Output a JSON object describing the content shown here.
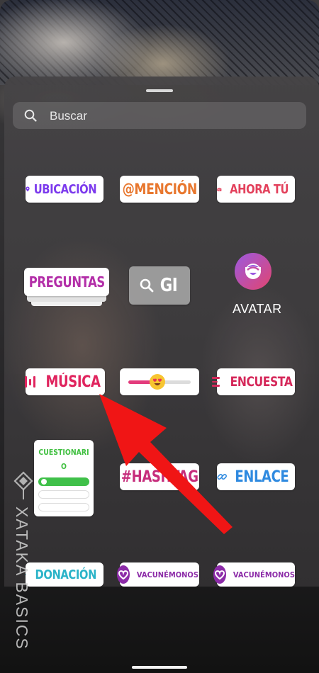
{
  "search": {
    "placeholder": "Buscar"
  },
  "stickers": {
    "ubicacion": "UBICACIÓN",
    "mencion": "@MENCIÓN",
    "ahora_tu": "AHORA TÚ",
    "preguntas": "PREGUNTAS",
    "gif": "GI",
    "avatar": "AVATAR",
    "musica": "MÚSICA",
    "encuesta": "ENCUESTA",
    "cuestionario_line1": "CUESTIONARI",
    "cuestionario_line2": "O",
    "hashtag": "#HASHTAG",
    "enlace": "ENLACE",
    "donacion": "DONACIÓN",
    "vacunemonos_1": "VACUNÉMONOS",
    "vacunemonos_2": "VACUNÉMONOS"
  },
  "slider": {
    "value_fraction": 0.5,
    "emoji": "😍"
  },
  "watermark": {
    "text": "XATAKA BASICS"
  },
  "colors": {
    "ubicacion": "#7c3aed",
    "mencion": "#e8772e",
    "ahora_tu": "#e3415c",
    "preguntas": "#b32ea8",
    "musica": "#e0245e",
    "encuesta": "#d5285a",
    "cuestionario": "#3fbf3f",
    "hashtag": "#c62d7c",
    "enlace": "#2f8ae0",
    "donacion": "#2ab3c8",
    "vacunemonos": "#8c2ba8",
    "arrow": "#f01515"
  },
  "icons": [
    "search-icon",
    "location-pin-icon",
    "camera-icon",
    "gif-search-icon",
    "avatar-face-icon",
    "music-bars-icon",
    "poll-lines-icon",
    "link-icon",
    "heart-icon",
    "vaccine-heart-icon",
    "xataka-logo-icon"
  ]
}
